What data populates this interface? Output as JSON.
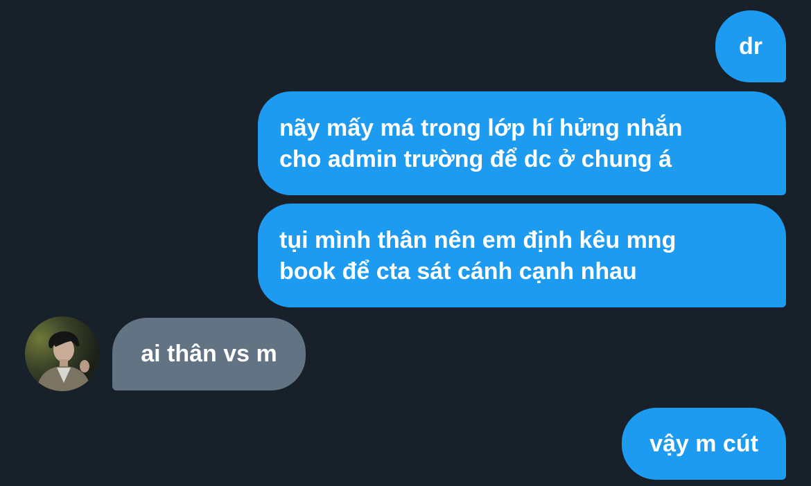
{
  "conversation": {
    "messages": [
      {
        "sender": "me",
        "lines": [
          "dr"
        ]
      },
      {
        "sender": "me",
        "lines": [
          "nãy mấy má trong lớp hí hửng nhắn",
          "cho admin trường để dc ở chung á"
        ]
      },
      {
        "sender": "me",
        "lines": [
          "tụi mình thân nên em định kêu mng",
          "book để cta sát cánh cạnh nhau"
        ]
      },
      {
        "sender": "other",
        "lines": [
          "ai thân vs m"
        ]
      },
      {
        "sender": "me",
        "lines": [
          "vậy m cút"
        ]
      }
    ]
  },
  "colors": {
    "background": "#18202a",
    "outgoing_bubble": "#1d9bf0",
    "incoming_bubble": "#627483",
    "text": "#ffffff"
  },
  "icons": {
    "avatar": "user-avatar-photo"
  }
}
